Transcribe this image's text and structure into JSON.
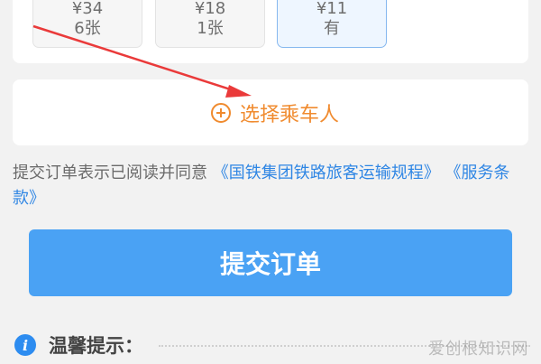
{
  "seat_options": [
    {
      "price": "¥34",
      "count": "6张"
    },
    {
      "price": "¥18",
      "count": "1张"
    },
    {
      "price": "¥11",
      "count": "有"
    }
  ],
  "passenger_section": {
    "add_label": "选择乘车人"
  },
  "agreement": {
    "prefix": "提交订单表示已阅读并同意",
    "rules_link": "《国铁集团铁路旅客运输规程》",
    "terms_link": "《服务条款》"
  },
  "submit": {
    "label": "提交订单"
  },
  "tips": {
    "label": "温馨提示："
  },
  "watermark": {
    "text": "爱创根知识网"
  },
  "colors": {
    "accent_blue": "#4aa2f4",
    "link_blue": "#2f86e4",
    "orange": "#f08b2f",
    "annotation_red": "#ea3a3a"
  },
  "icons": {
    "plus": "plus-circle-icon",
    "info": "info-icon"
  }
}
